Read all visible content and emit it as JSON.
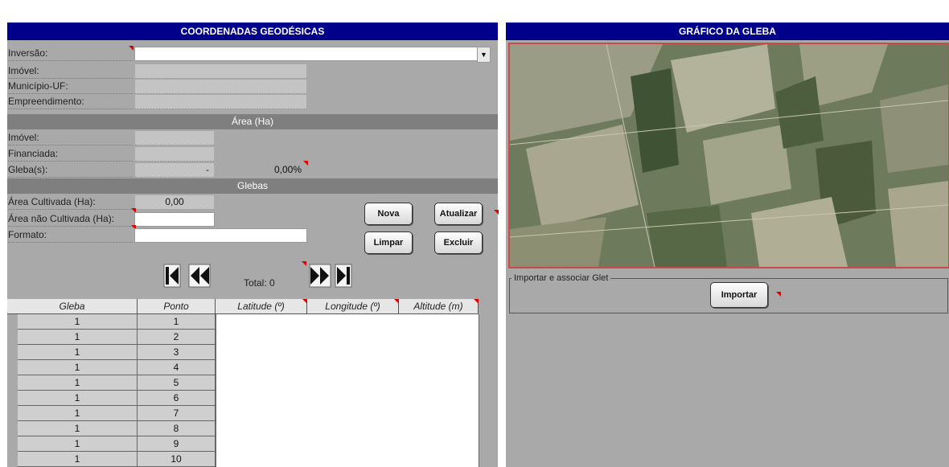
{
  "left": {
    "title": "COORDENADAS GEODÉSICAS",
    "labels": {
      "inversao": "Inversão:",
      "imovel": "Imóvel:",
      "municipio": "Município-UF:",
      "empreendimento": "Empreendimento:"
    },
    "area_band": "Área (Ha)",
    "area_labels": {
      "imovel": "Imóvel:",
      "financiada": "Financiada:",
      "glebas": "Gleba(s):"
    },
    "area_values": {
      "glebas_value": "-",
      "glebas_percent": "0,00%"
    },
    "glebas_band": "Glebas",
    "glebas_labels": {
      "area_cultivada": "Área Cultivada (Ha):",
      "area_nao_cultivada": "Área não Cultivada (Ha):",
      "formato": "Formato:"
    },
    "glebas_values": {
      "area_cultivada": "0,00"
    },
    "buttons": {
      "nova": "Nova",
      "atualizar": "Atualizar",
      "limpar": "Limpar",
      "excluir": "Excluir"
    },
    "total_label": "Total: 0",
    "table": {
      "headers": [
        "Gleba",
        "Ponto",
        "Latitude (º)",
        "Longitude (º)",
        "Altitude (m)"
      ],
      "rows": [
        [
          "1",
          "1"
        ],
        [
          "1",
          "2"
        ],
        [
          "1",
          "3"
        ],
        [
          "1",
          "4"
        ],
        [
          "1",
          "5"
        ],
        [
          "1",
          "6"
        ],
        [
          "1",
          "7"
        ],
        [
          "1",
          "8"
        ],
        [
          "1",
          "9"
        ],
        [
          "1",
          "10"
        ]
      ]
    }
  },
  "right": {
    "title": "GRÁFICO DA GLEBA",
    "import_group": "Importar e associar Glet",
    "import_button": "Importar"
  },
  "colors": {
    "title_bar": "#00008b",
    "panel_bg": "#a9a9a9",
    "band_bg": "#7f7f7f",
    "comment_mark": "#e00000"
  }
}
